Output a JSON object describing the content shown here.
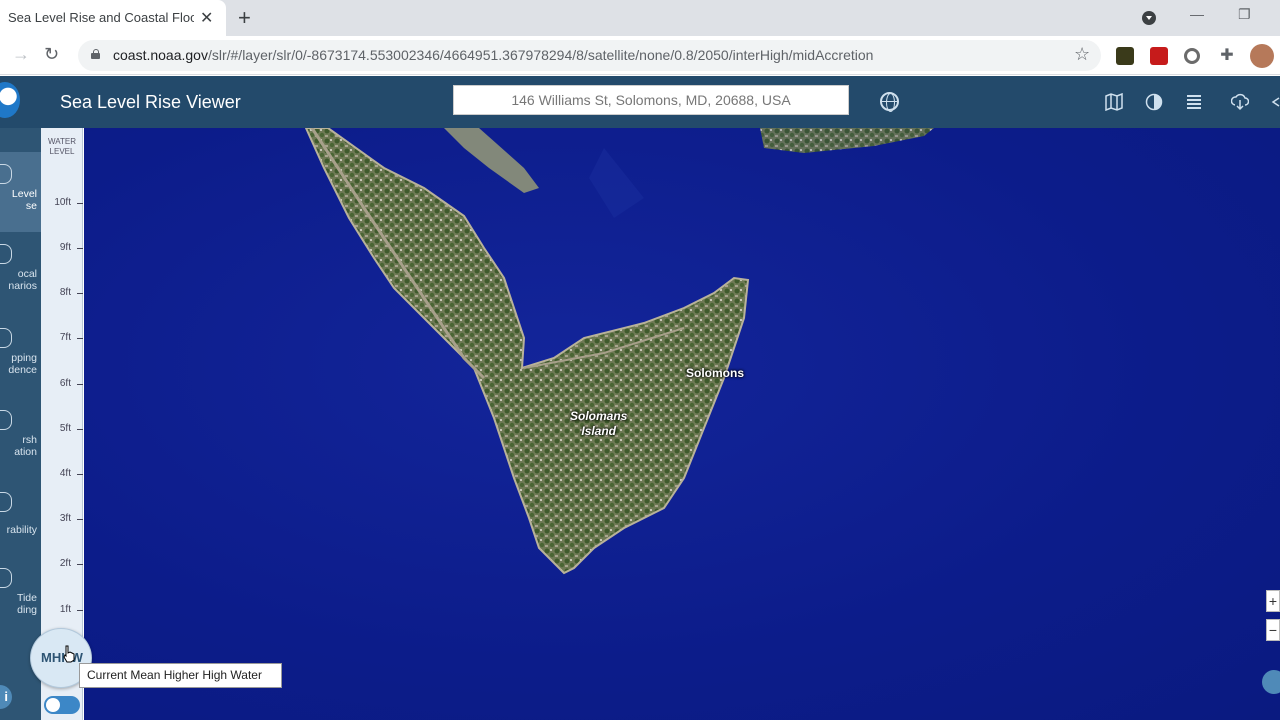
{
  "browser": {
    "tab_title": "Sea Level Rise and Coastal Flood",
    "url_host": "coast.noaa.gov",
    "url_path": "/slr/#/layer/slr/0/-8673174.553002346/4664951.367978294/8/satellite/none/0.8/2050/interHigh/midAccretion"
  },
  "app": {
    "title": "Sea Level Rise Viewer",
    "search_value": "146 Williams St, Solomons, MD, 20688, USA"
  },
  "sidebar": {
    "items": [
      {
        "label1": "Level",
        "label2": "se",
        "icon": "water-drop-icon",
        "active": true
      },
      {
        "label1": "ocal",
        "label2": "narios",
        "icon": "house-icon",
        "active": false
      },
      {
        "label1": "pping",
        "label2": "dence",
        "icon": "map-icon",
        "active": false
      },
      {
        "label1": "rsh",
        "label2": "ation",
        "icon": "marsh-icon",
        "active": false
      },
      {
        "label1": "rability",
        "label2": "",
        "icon": "person-icon",
        "active": false
      },
      {
        "label1": "Tide",
        "label2": "ding",
        "icon": "wave-icon",
        "active": false
      }
    ],
    "info_label": "i"
  },
  "water_level": {
    "title_line1": "WATER",
    "title_line2": "LEVEL",
    "ticks": [
      "10ft",
      "9ft",
      "8ft",
      "7ft",
      "6ft",
      "5ft",
      "4ft",
      "3ft",
      "2ft",
      "1ft"
    ],
    "button_label": "MHHW",
    "tooltip": "Current Mean Higher High Water"
  },
  "map": {
    "labels": {
      "solomons": "Solomons",
      "island_line1": "Solomans",
      "island_line2": "Island"
    },
    "zoom_in": "+",
    "zoom_out": "−"
  }
}
